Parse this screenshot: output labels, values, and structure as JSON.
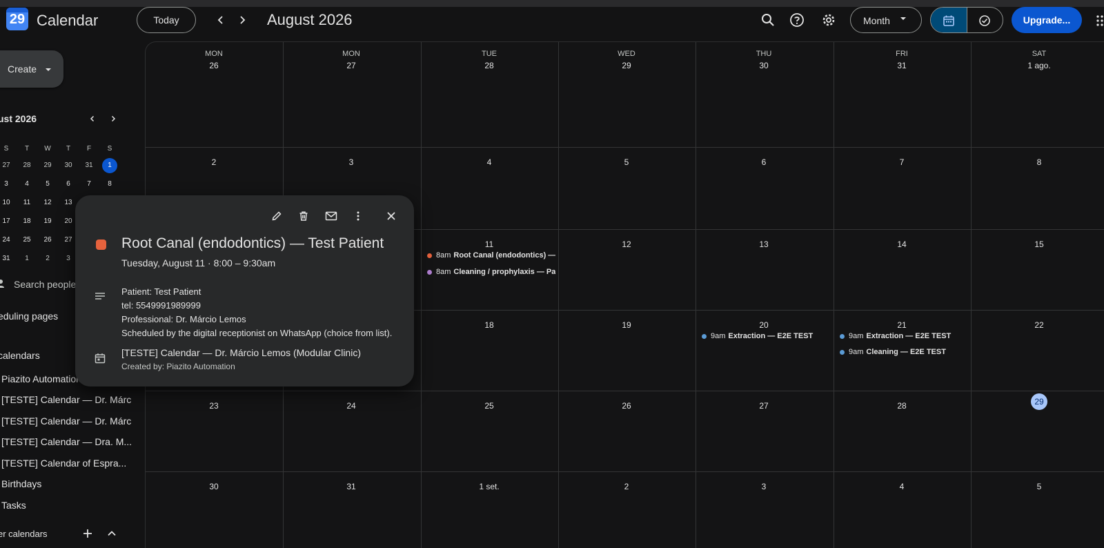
{
  "app": {
    "logo_text": "29",
    "title": "Calendar"
  },
  "header": {
    "today_label": "Today",
    "month_label": "August 2026",
    "view_label": "Month",
    "upgrade_label": "Upgrade..."
  },
  "sidebar": {
    "create_label": "Create",
    "mini_title": "ust 2026",
    "mini_dow": [
      "S",
      "T",
      "W",
      "T",
      "F",
      "S"
    ],
    "mini_rows": [
      [
        "27",
        "28",
        "29",
        "30",
        "31",
        "1"
      ],
      [
        "3",
        "4",
        "5",
        "6",
        "7",
        "8"
      ],
      [
        "10",
        "11",
        "12",
        "13"
      ],
      [
        "17",
        "18",
        "19",
        "20"
      ],
      [
        "24",
        "25",
        "26",
        "27"
      ],
      [
        "31",
        "1",
        "2",
        "3"
      ]
    ],
    "search_people": "Search people",
    "scheduling_pages": "eduling pages",
    "my_calendars": "calendars",
    "calendars": [
      "Piazito Automation",
      "[TESTE] Calendar — Dr. Márc",
      "[TESTE] Calendar — Dr. Márc",
      "[TESTE] Calendar — Dra. M...",
      "[TESTE] Calendar of Espra...",
      "Birthdays",
      "Tasks"
    ],
    "other_calendars": "er calendars"
  },
  "grid": {
    "dow": [
      "MON",
      "MON",
      "TUE",
      "WED",
      "THU",
      "FRI",
      "SAT"
    ],
    "weeks": [
      [
        "26",
        "27",
        "28",
        "29",
        "30",
        "31",
        "1 ago."
      ],
      [
        "2",
        "3",
        "4",
        "5",
        "6",
        "7",
        "8"
      ],
      [
        "",
        "",
        "11",
        "12",
        "13",
        "14",
        "15"
      ],
      [
        "",
        "",
        "18",
        "19",
        "20",
        "21",
        "22"
      ],
      [
        "23",
        "24",
        "25",
        "26",
        "27",
        "28",
        "29"
      ],
      [
        "30",
        "31",
        "1 set.",
        "2",
        "3",
        "4",
        "5"
      ]
    ],
    "today": "29"
  },
  "events": [
    {
      "time": "8am",
      "title": "Root Canal (endodontics) — Pat",
      "color": "#e6623d"
    },
    {
      "time": "8am",
      "title": "Cleaning / prophylaxis — Pat",
      "color": "#b07fd0"
    },
    {
      "time": "9am",
      "title": "Extraction — E2E TEST",
      "color": "#5b9bd5"
    },
    {
      "time": "9am",
      "title": "Extraction — E2E TEST",
      "color": "#5b9bd5"
    },
    {
      "time": "9am",
      "title": "Cleaning — E2E TEST",
      "color": "#5b9bd5"
    }
  ],
  "popover": {
    "title": "Root Canal (endodontics) — Test Patient",
    "when": "Tuesday, August 11  ·  8:00 – 9:30am",
    "description": [
      "Patient: Test Patient",
      "tel: 5549991989999",
      "Professional: Dr. Márcio Lemos",
      "Scheduled by the digital receptionist on WhatsApp (choice from list)."
    ],
    "calendar": "[TESTE] Calendar — Dr. Márcio Lemos (Modular Clinic)",
    "created_by": "Created by: Piazito Automation",
    "color": "#e6623d"
  },
  "colors": {
    "accent": "#0b57d0",
    "today_bg": "#a8c7fa",
    "view_toggle_active": "#004a77"
  }
}
